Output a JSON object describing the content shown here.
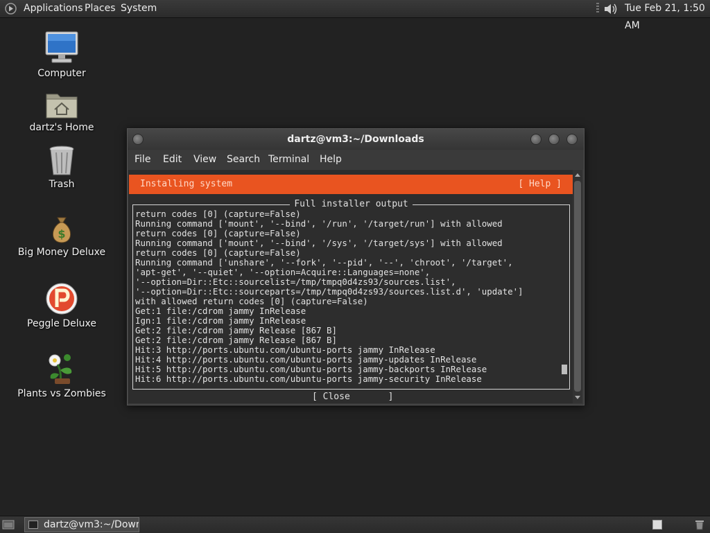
{
  "top_panel": {
    "menus": [
      "Applications",
      "Places",
      "System"
    ],
    "clock": "Tue Feb 21,  1:50 AM"
  },
  "desktop_icons": [
    {
      "label": "Computer",
      "icon": "computer-icon"
    },
    {
      "label": "dartz's Home",
      "icon": "home-folder-icon"
    },
    {
      "label": "Trash",
      "icon": "trash-icon"
    },
    {
      "label": "Big Money Deluxe",
      "icon": "money-bag-icon"
    },
    {
      "label": "Peggle Deluxe",
      "icon": "peggle-icon"
    },
    {
      "label": "Plants vs Zombies",
      "icon": "plants-icon"
    }
  ],
  "window": {
    "title": "dartz@vm3:~/Downloads",
    "menu": [
      "File",
      "Edit",
      "View",
      "Search",
      "Terminal",
      "Help"
    ]
  },
  "installer": {
    "status": "Installing system",
    "help": "[ Help ]",
    "output_title": "Full installer output",
    "close": "[ Close       ]",
    "log": [
      "return codes [0] (capture=False)",
      "Running command ['mount', '--bind', '/run', '/target/run'] with allowed",
      "return codes [0] (capture=False)",
      "Running command ['mount', '--bind', '/sys', '/target/sys'] with allowed",
      "return codes [0] (capture=False)",
      "Running command ['unshare', '--fork', '--pid', '--', 'chroot', '/target',",
      "'apt-get', '--quiet', '--option=Acquire::Languages=none',",
      "'--option=Dir::Etc::sourcelist=/tmp/tmpq0d4zs93/sources.list',",
      "'--option=Dir::Etc::sourceparts=/tmp/tmpq0d4zs93/sources.list.d', 'update']",
      "with allowed return codes [0] (capture=False)",
      "Get:1 file:/cdrom jammy InRelease",
      "Ign:1 file:/cdrom jammy InRelease",
      "Get:2 file:/cdrom jammy Release [867 B]",
      "Get:2 file:/cdrom jammy Release [867 B]",
      "Hit:3 http://ports.ubuntu.com/ubuntu-ports jammy InRelease",
      "Hit:4 http://ports.ubuntu.com/ubuntu-ports jammy-updates InRelease",
      "Hit:5 http://ports.ubuntu.com/ubuntu-ports jammy-backports InRelease",
      "Hit:6 http://ports.ubuntu.com/ubuntu-ports jammy-security InRelease"
    ]
  },
  "taskbar": {
    "task_label": "dartz@vm3:~/Down..."
  },
  "colors": {
    "accent": "#e95420",
    "terminal_bg": "#2d2d2d",
    "desktop_bg": "#222222"
  }
}
